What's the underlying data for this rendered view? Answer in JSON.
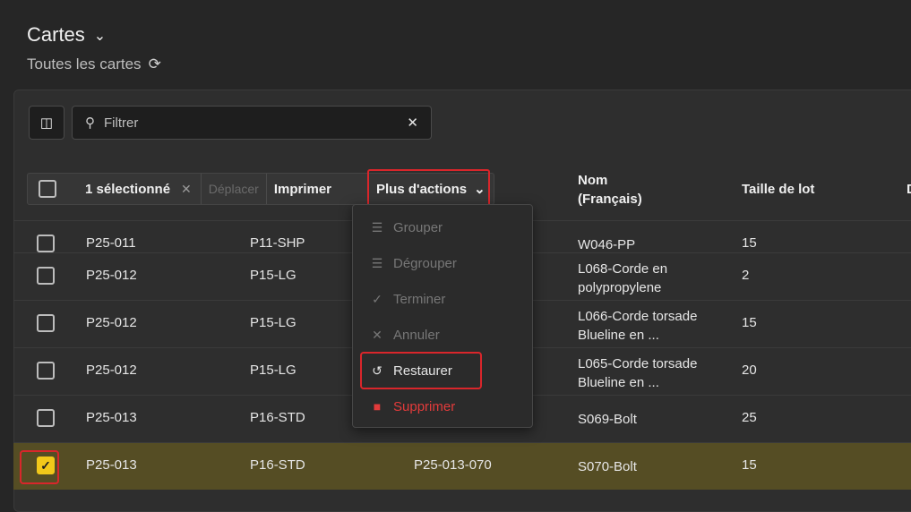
{
  "page": {
    "title": "Cartes",
    "subtitle": "Toutes les cartes"
  },
  "filter": {
    "placeholder": "Filtrer"
  },
  "toolbar": {
    "selected": "1 sélectionné",
    "move": "Déplacer",
    "print": "Imprimer",
    "more_actions": "Plus d'actions"
  },
  "columns": {
    "name_line1": "Nom",
    "name_line2": "(Français)",
    "lot_size": "Taille de lot",
    "next_col": "D"
  },
  "menu": {
    "items": [
      {
        "label": "Grouper",
        "icon": "layers-icon",
        "state": "disabled"
      },
      {
        "label": "Dégrouper",
        "icon": "ungroup-icon",
        "state": "disabled"
      },
      {
        "label": "Terminer",
        "icon": "check-icon",
        "state": "disabled"
      },
      {
        "label": "Annuler",
        "icon": "x-icon",
        "state": "disabled"
      },
      {
        "label": "Restaurer",
        "icon": "undo-icon",
        "state": "enabled"
      },
      {
        "label": "Supprimer",
        "icon": "trash-icon",
        "state": "danger"
      }
    ]
  },
  "rows": [
    {
      "c1": "P25-011",
      "c2": "P11-SHP",
      "c3": "",
      "name1": "W046-PP",
      "name2": "",
      "lot": "15",
      "checked": false
    },
    {
      "c1": "P25-012",
      "c2": "P15-LG",
      "c3": "",
      "name1": "L068-Corde en",
      "name2": "polypropylene",
      "lot": "2",
      "checked": false
    },
    {
      "c1": "P25-012",
      "c2": "P15-LG",
      "c3": "",
      "name1": "L066-Corde torsade",
      "name2": "Blueline en ...",
      "lot": "15",
      "checked": false
    },
    {
      "c1": "P25-012",
      "c2": "P15-LG",
      "c3": "",
      "name1": "L065-Corde torsade",
      "name2": "Blueline en ...",
      "lot": "20",
      "checked": false
    },
    {
      "c1": "P25-013",
      "c2": "P16-STD",
      "c3": "",
      "name1": "S069-Bolt",
      "name2": "",
      "lot": "25",
      "checked": false
    },
    {
      "c1": "P25-013",
      "c2": "P16-STD",
      "c3": "P25-013-070",
      "name1": "S070-Bolt",
      "name2": "",
      "lot": "15",
      "checked": true
    }
  ],
  "colors": {
    "accent_yellow": "#f2c81a",
    "highlight_red": "#d9262b",
    "selected_row": "#554d24"
  }
}
